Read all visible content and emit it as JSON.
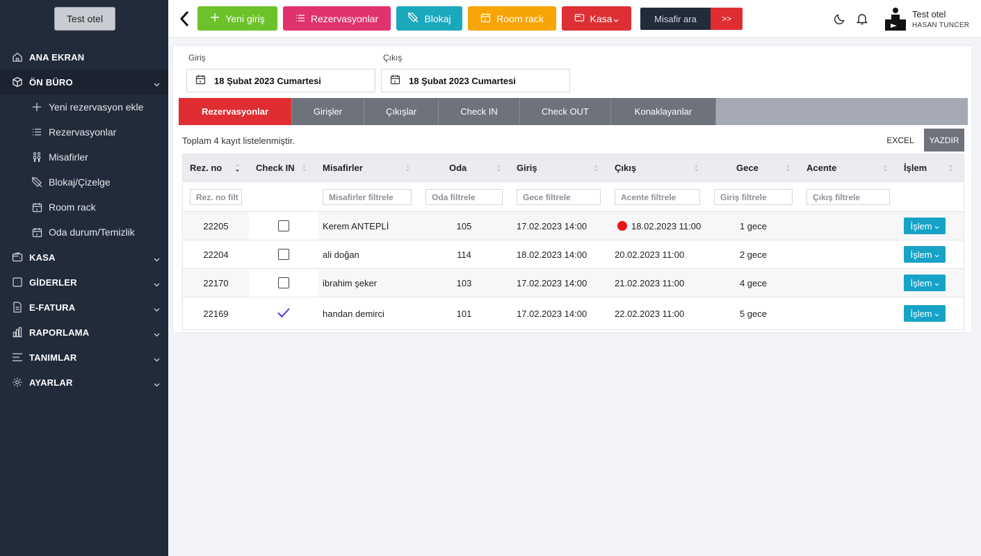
{
  "sidebar": {
    "hotel_button": "Test otel",
    "items": [
      {
        "label": "ANA EKRAN",
        "icon": "home-icon"
      },
      {
        "label": "ÖN BÜRO",
        "icon": "box-icon",
        "expanded": true,
        "children": [
          {
            "label": "Yeni rezervasyon ekle",
            "icon": "plus-icon"
          },
          {
            "label": "Rezervasyonlar",
            "icon": "list-icon"
          },
          {
            "label": "Misafirler",
            "icon": "people-icon"
          },
          {
            "label": "Blokaj/Çizelge",
            "icon": "tag-icon"
          },
          {
            "label": "Room rack",
            "icon": "calendar-icon"
          },
          {
            "label": "Oda durum/Temizlik",
            "icon": "calendar-icon"
          }
        ]
      },
      {
        "label": "KASA",
        "icon": "wallet-icon"
      },
      {
        "label": "GİDERLER",
        "icon": "grid-icon"
      },
      {
        "label": "E-FATURA",
        "icon": "invoice-icon"
      },
      {
        "label": "RAPORLAMA",
        "icon": "bar-chart-icon"
      },
      {
        "label": "TANIMLAR",
        "icon": "menu-lines-icon"
      },
      {
        "label": "AYARLAR",
        "icon": "gear-icon"
      }
    ]
  },
  "topbar": {
    "buttons": [
      {
        "label": "Yeni giriş",
        "color": "#6cc22a",
        "icon": "plus-icon"
      },
      {
        "label": "Rezervasyonlar",
        "color": "#e0326e",
        "icon": "list-icon"
      },
      {
        "label": "Blokaj",
        "color": "#1aa8bd",
        "icon": "tag-icon"
      },
      {
        "label": "Room rack",
        "color": "#f7a406",
        "icon": "calendar-icon"
      },
      {
        "label": "Kasa",
        "color": "#dd2f34",
        "icon": "wallet-icon"
      }
    ],
    "guest_search": "Misafir ara",
    "guest_go": ">>",
    "user_name": "Test otel",
    "user_sub": "HASAN TUNCER"
  },
  "filters": {
    "checkin_label": "Giriş",
    "checkin_value": "18 Şubat 2023 Cumartesi",
    "checkout_label": "Çıkış",
    "checkout_value": "18 Şubat 2023 Cumartesi"
  },
  "tabs": [
    "Rezervasyonlar",
    "Girişler",
    "Çıkışlar",
    "Check IN",
    "Check OUT",
    "Konaklayanlar"
  ],
  "total_text": "Toplam 4 kayıt listelenmiştir.",
  "actions": {
    "excel": "EXCEL",
    "print": "YAZDIR"
  },
  "table": {
    "headers": [
      "Rez. no",
      "Check IN",
      "Misafirler",
      "Oda",
      "Giriş",
      "Çıkış",
      "Gece",
      "Acente",
      "İşlem"
    ],
    "filters": [
      "Rez. no filt",
      "Misafirler filtrele",
      "Oda filtrele",
      "Gece filtrele",
      "Acente filtrele",
      "Giriş filtrele",
      "Çıkış filtrele"
    ],
    "rows": [
      {
        "rez": "22205",
        "checked": false,
        "guest": "Kerem ANTEPLİ",
        "room": "105",
        "in": "17.02.2023 14:00",
        "out": "18.02.2023 11:00",
        "alert": true,
        "nights": "1 gece",
        "agency": "",
        "action": "İşlem"
      },
      {
        "rez": "22204",
        "checked": false,
        "guest": "ali doğan",
        "room": "114",
        "in": "18.02.2023 14:00",
        "out": "20.02.2023 11:00",
        "alert": false,
        "nights": "2 gece",
        "agency": "",
        "action": "İşlem"
      },
      {
        "rez": "22170",
        "checked": false,
        "guest": "ibrahim şeker",
        "room": "103",
        "in": "17.02.2023 14:00",
        "out": "21.02.2023 11:00",
        "alert": false,
        "nights": "4 gece",
        "agency": "",
        "action": "İşlem"
      },
      {
        "rez": "22169",
        "checked": true,
        "guest": "handan demirci",
        "room": "101",
        "in": "17.02.2023 14:00",
        "out": "22.02.2023 11:00",
        "alert": false,
        "nights": "5 gece",
        "agency": "",
        "action": "İşlem"
      }
    ]
  },
  "colors": {
    "sidebar": "#222b3a",
    "accent_red": "#e02d31",
    "action_blue": "#17a2c7"
  }
}
